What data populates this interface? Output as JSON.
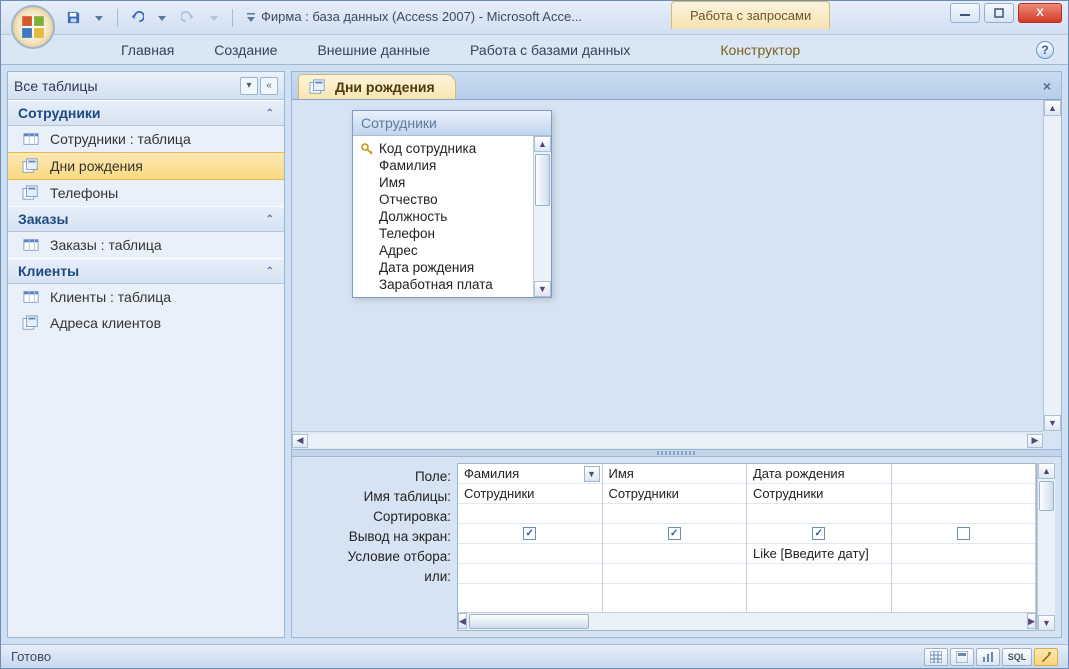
{
  "titlebar": {
    "title": "Фирма : база данных (Access 2007)  -  Microsoft Acce...",
    "context_label": "Работа с запросами"
  },
  "ribbon": {
    "tabs": [
      "Главная",
      "Создание",
      "Внешние данные",
      "Работа с базами данных"
    ],
    "context_tab": "Конструктор"
  },
  "navpane": {
    "header": "Все таблицы",
    "groups": [
      {
        "title": "Сотрудники",
        "items": [
          {
            "label": "Сотрудники : таблица",
            "type": "table",
            "selected": false
          },
          {
            "label": "Дни рождения",
            "type": "query",
            "selected": true
          },
          {
            "label": "Телефоны",
            "type": "query",
            "selected": false
          }
        ]
      },
      {
        "title": "Заказы",
        "items": [
          {
            "label": "Заказы : таблица",
            "type": "table",
            "selected": false
          }
        ]
      },
      {
        "title": "Клиенты",
        "items": [
          {
            "label": "Клиенты : таблица",
            "type": "table",
            "selected": false
          },
          {
            "label": "Адреса клиентов",
            "type": "query",
            "selected": false
          }
        ]
      }
    ]
  },
  "document": {
    "tab_title": "Дни рождения",
    "table_box": {
      "title": "Сотрудники",
      "fields": [
        "Код сотрудника",
        "Фамилия",
        "Имя",
        "Отчество",
        "Должность",
        "Телефон",
        "Адрес",
        "Дата рождения",
        "Заработная плата"
      ],
      "primary_key_index": 0
    },
    "grid": {
      "row_labels": [
        "Поле:",
        "Имя таблицы:",
        "Сортировка:",
        "Вывод на экран:",
        "Условие отбора:",
        "или:"
      ],
      "columns": [
        {
          "field": "Фамилия",
          "table": "Сотрудники",
          "sort": "",
          "show": true,
          "criteria": "",
          "or": "",
          "has_dropdown": true
        },
        {
          "field": "Имя",
          "table": "Сотрудники",
          "sort": "",
          "show": true,
          "criteria": "",
          "or": "",
          "has_dropdown": false
        },
        {
          "field": "Дата рождения",
          "table": "Сотрудники",
          "sort": "",
          "show": true,
          "criteria": "Like [Введите дату]",
          "or": "",
          "has_dropdown": false
        }
      ]
    }
  },
  "statusbar": {
    "text": "Готово",
    "sql_label": "SQL"
  }
}
